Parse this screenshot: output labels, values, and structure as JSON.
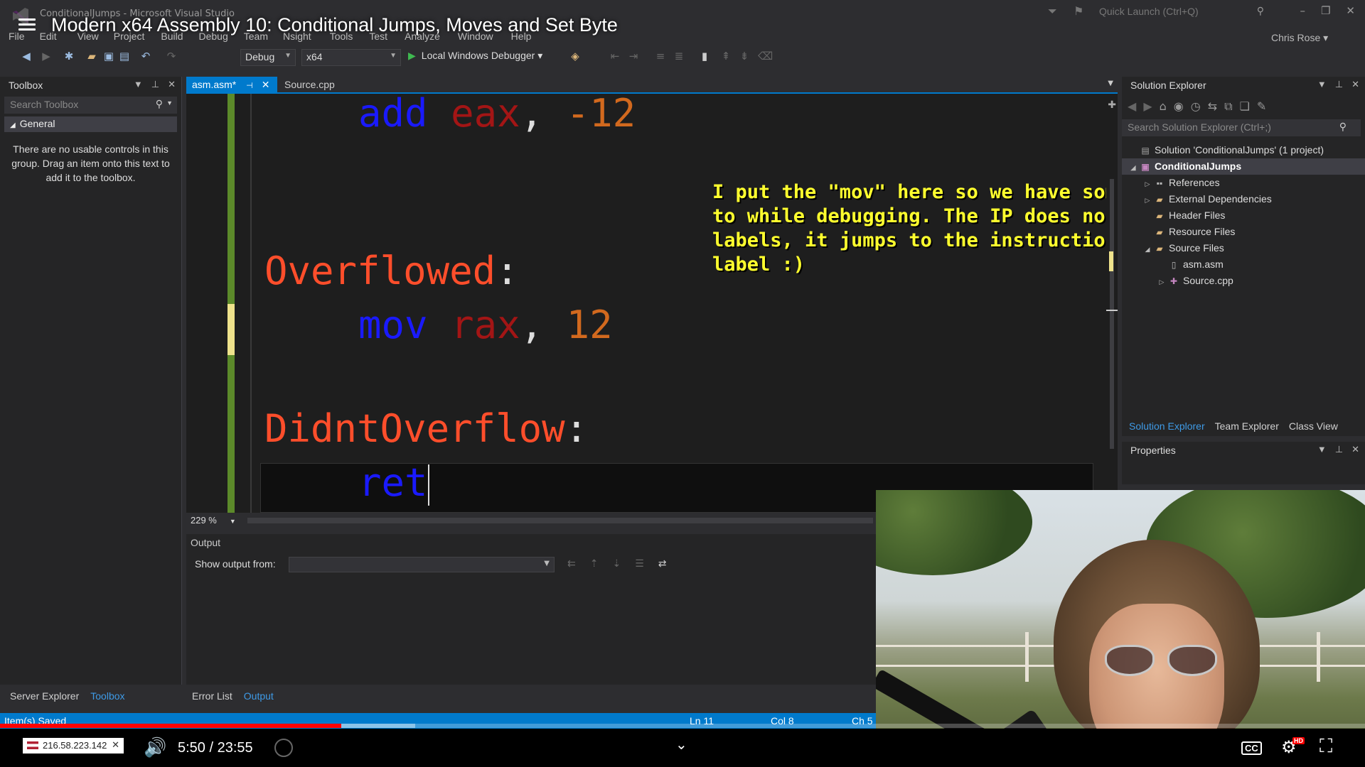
{
  "window": {
    "title": "ConditionalJumps - Microsoft Visual Studio",
    "video_title": "Modern x64 Assembly 10: Conditional Jumps, Moves and Set Byte",
    "quick_launch_placeholder": "Quick Launch (Ctrl+Q)",
    "user": "Chris Rose"
  },
  "menu": [
    "File",
    "Edit",
    "View",
    "Project",
    "Build",
    "Debug",
    "Team",
    "Nsight",
    "Tools",
    "Test",
    "Analyze",
    "Window",
    "Help"
  ],
  "toolbar": {
    "config": "Debug",
    "platform": "x64",
    "debugger": "Local Windows Debugger"
  },
  "toolbox": {
    "title": "Toolbox",
    "search_placeholder": "Search Toolbox",
    "group": "General",
    "message": "There are no usable controls in this group. Drag an item onto this text to add it to the toolbox.",
    "bottom_tabs": [
      "Server Explorer",
      "Toolbox"
    ],
    "active_tab": "Toolbox"
  },
  "editor": {
    "tabs": [
      {
        "label": "asm.asm*",
        "active": true
      },
      {
        "label": "Source.cpp",
        "active": false
      }
    ],
    "lines": [
      {
        "kw": "add",
        "reg": "eax",
        "num": "-12"
      },
      {
        "label": "Overflowed"
      },
      {
        "kw": "mov",
        "reg": "rax",
        "num": "12"
      },
      {
        "label": "DidntOverflow"
      },
      {
        "kw": "ret"
      }
    ],
    "annotation": "I put the \"mov\" here so we have something to step to while debugging. The IP does not jump to labels, it jumps to the instruction following a label :)",
    "zoom": "229 %"
  },
  "output": {
    "title": "Output",
    "show_from_label": "Show output from:",
    "source_value": ""
  },
  "bottom_panel_tabs": [
    "Error List",
    "Output"
  ],
  "bottom_panel_active": "Output",
  "solution_explorer": {
    "title": "Solution Explorer",
    "search_placeholder": "Search Solution Explorer (Ctrl+;)",
    "solution": "Solution 'ConditionalJumps' (1 project)",
    "project": "ConditionalJumps",
    "nodes": [
      "References",
      "External Dependencies",
      "Header Files",
      "Resource Files",
      "Source Files",
      "asm.asm",
      "Source.cpp"
    ],
    "tabs": [
      "Solution Explorer",
      "Team Explorer",
      "Class View"
    ],
    "active_tab": "Solution Explorer"
  },
  "properties": {
    "title": "Properties"
  },
  "status": {
    "message": "Item(s) Saved",
    "line": "Ln 11",
    "col": "Col 8",
    "ch": "Ch 5"
  },
  "player": {
    "ip": "216.58.223.142",
    "time": "5:50 / 23:55",
    "played_fraction": 0.25,
    "buffered_fraction": 0.304,
    "hd_badge": "HD",
    "cc_label": "CC"
  },
  "colors": {
    "accent": "#007acc",
    "keyword": "#1a1aff",
    "register": "#a31515",
    "number": "#d2691e",
    "label": "#ff4e2b",
    "annotation": "#ffff2e",
    "progress": "#ff0000"
  }
}
